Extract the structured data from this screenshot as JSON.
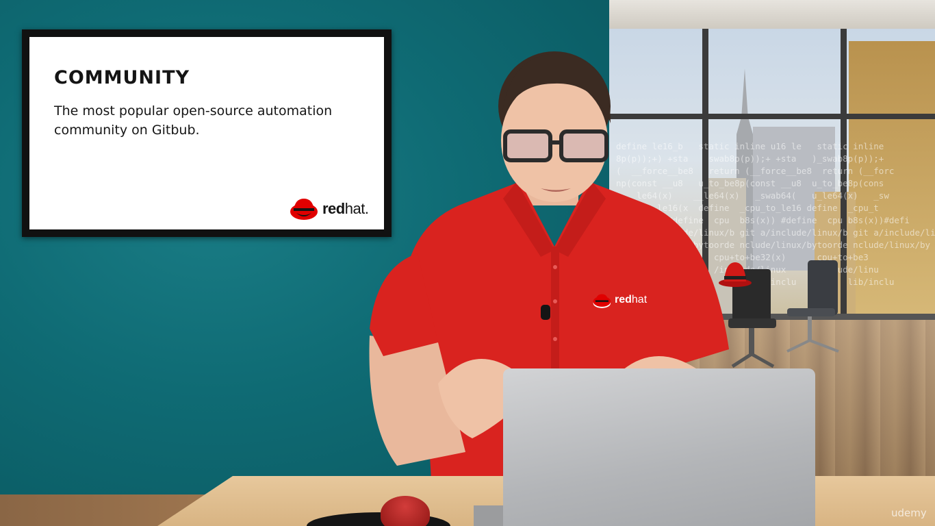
{
  "slide": {
    "title": "COMMUNITY",
    "body": "The most popular open-source automation community on Gitbub.",
    "logo": {
      "brand_bold": "red",
      "brand_light": "hat.",
      "icon": "redhat-shadowman-icon"
    }
  },
  "shirt_logo": {
    "brand_bold": "red",
    "brand_light": "hat",
    "icon": "redhat-shadowman-icon"
  },
  "watermark": "udemy",
  "code_overlay": "define le16_b   static inline u16 le   static inline\n8p(p));+) +sta    swab8p(p));+ +sta   )_swab8p(p));+\n(  __force__be8   return (__force__be8  return (__forc\nnp(const __u8   u_to_be8p(const __u8  u_to_be8p(cons\n    le64(x)    __le64(x)   _swab64(   u_le64(x)   _sw\n  pu_to_le16(x  define  _cpu_to_le16 define  _cpu_t\n  b8(x))  #define  cpu  b8s(x)) #define  cpu b8s(x))#defi\n  git a/include/linux/b git a/include/linux/b git a/include/li\n  nclude/linux/bytoorde nclude/linux/bytoorde nclude/linux/by\n   cpu+to+be32(x)  cpu+to+be32(x)      cpu+to+be3\n   include/linux   /include/linux     /include/linu\n   b   ib/inclu      b    lib/inclu     b    lib/inclu",
  "colors": {
    "teal_wall": "#0f6a73",
    "redhat_red": "#e00000",
    "polo_red": "#d9231f"
  }
}
